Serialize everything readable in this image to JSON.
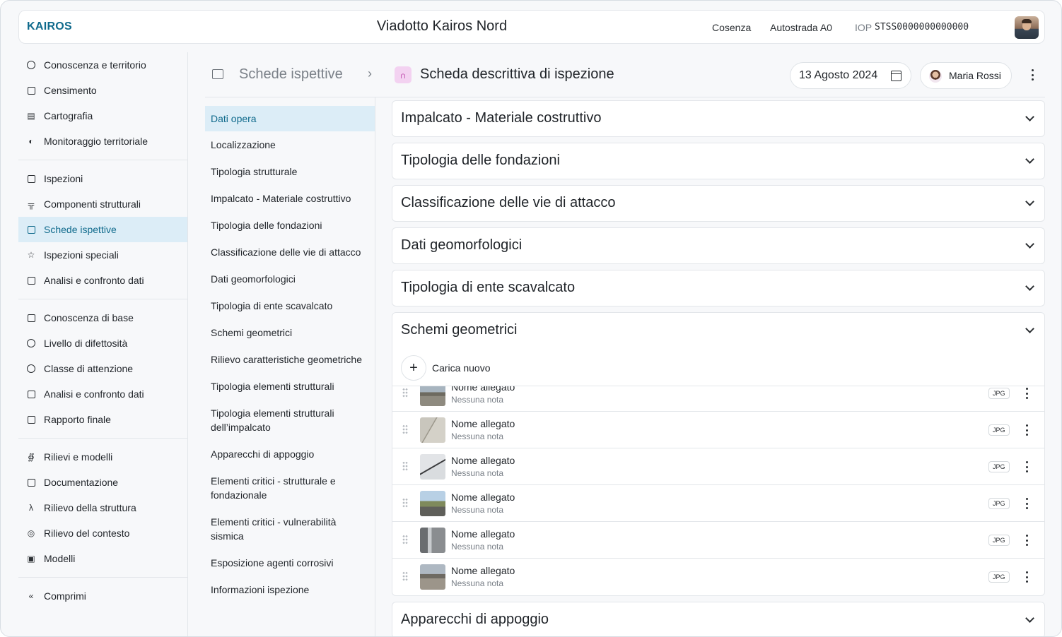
{
  "topbar": {
    "logo": "KAIROS",
    "title": "Viadotto Kairos Nord",
    "location": "Cosenza",
    "road": "Autostrada A0",
    "iop_label": "IOP",
    "iop_value": "STSS0000000000000"
  },
  "nav": {
    "groups": [
      [
        {
          "label": "Conoscenza e territorio",
          "icon": "globe-icon"
        },
        {
          "label": "Censimento",
          "icon": "document-icon"
        },
        {
          "label": "Cartografia",
          "icon": "map-icon"
        },
        {
          "label": "Monitoraggio territoriale",
          "icon": "earth-icon"
        }
      ],
      [
        {
          "label": "Ispezioni",
          "icon": "edit-square-icon"
        },
        {
          "label": "Componenti strutturali",
          "icon": "bridge-icon"
        },
        {
          "label": "Schede ispettive",
          "icon": "form-icon",
          "active": true
        },
        {
          "label": "Ispezioni speciali",
          "icon": "star-icon"
        },
        {
          "label": "Analisi e confronto dati",
          "icon": "bar-chart-icon"
        }
      ],
      [
        {
          "label": "Conoscenza di base",
          "icon": "line-chart-icon"
        },
        {
          "label": "Livello di difettosità",
          "icon": "gauge-icon"
        },
        {
          "label": "Classe di attenzione",
          "icon": "alert-circle-icon"
        },
        {
          "label": "Analisi e confronto dati",
          "icon": "bar-chart-icon"
        },
        {
          "label": "Rapporto finale",
          "icon": "report-icon"
        }
      ],
      [
        {
          "label": "Rilievi e modelli",
          "icon": "share-nodes-icon"
        },
        {
          "label": "Documentazione",
          "icon": "document-icon"
        },
        {
          "label": "Rilievo della struttura",
          "icon": "compass-icon"
        },
        {
          "label": "Rilievo del contesto",
          "icon": "target-icon"
        },
        {
          "label": "Modelli",
          "icon": "scan-icon"
        }
      ],
      [
        {
          "label": "Comprimi",
          "icon": "double-chevron-left-icon"
        }
      ]
    ]
  },
  "header": {
    "breadcrumb_parent": "Schede ispettive",
    "title": "Scheda descrittiva di ispezione",
    "date": "13 Agosto 2024",
    "user": "Maria Rossi"
  },
  "sections": [
    {
      "label": "Dati opera",
      "active": true
    },
    {
      "label": "Localizzazione"
    },
    {
      "label": "Tipologia strutturale"
    },
    {
      "label": "Impalcato - Materiale costruttivo"
    },
    {
      "label": "Tipologia delle fondazioni"
    },
    {
      "label": "Classificazione delle vie di attacco"
    },
    {
      "label": "Dati geomorfologici"
    },
    {
      "label": "Tipologia di ente scavalcato"
    },
    {
      "label": "Schemi geometrici"
    },
    {
      "label": "Rilievo caratteristiche geometriche"
    },
    {
      "label": "Tipologia elementi strutturali"
    },
    {
      "label": "Tipologia elementi strutturali dell’impalcato"
    },
    {
      "label": "Apparecchi di appoggio"
    },
    {
      "label": "Elementi critici - strutturale e fondazionale"
    },
    {
      "label": "Elementi critici - vulnerabilità sismica"
    },
    {
      "label": "Esposizione agenti corrosivi"
    },
    {
      "label": "Informazioni ispezione"
    }
  ],
  "accordions_before": [
    "Impalcato - Materiale costruttivo",
    "Tipologia delle fondazioni",
    "Classificazione delle vie di attacco",
    "Dati geomorfologici",
    "Tipologia di ente scavalcato"
  ],
  "open_accordion": {
    "title": "Schemi geometrici",
    "upload_label": "Carica nuovo",
    "attachments": [
      {
        "name": "Nome allegato",
        "note": "Nessuna nota",
        "type": "JPG"
      },
      {
        "name": "Nome allegato",
        "note": "Nessuna nota",
        "type": "JPG"
      },
      {
        "name": "Nome allegato",
        "note": "Nessuna nota",
        "type": "JPG"
      },
      {
        "name": "Nome allegato",
        "note": "Nessuna nota",
        "type": "JPG"
      },
      {
        "name": "Nome allegato",
        "note": "Nessuna nota",
        "type": "JPG"
      },
      {
        "name": "Nome allegato",
        "note": "Nessuna nota",
        "type": "JPG"
      }
    ]
  },
  "accordions_after": [
    "Apparecchi di appoggio"
  ],
  "colors": {
    "accent": "#0f6a8c",
    "active_bg": "#dcedf7",
    "form_icon_bg": "#f3d2f1"
  }
}
